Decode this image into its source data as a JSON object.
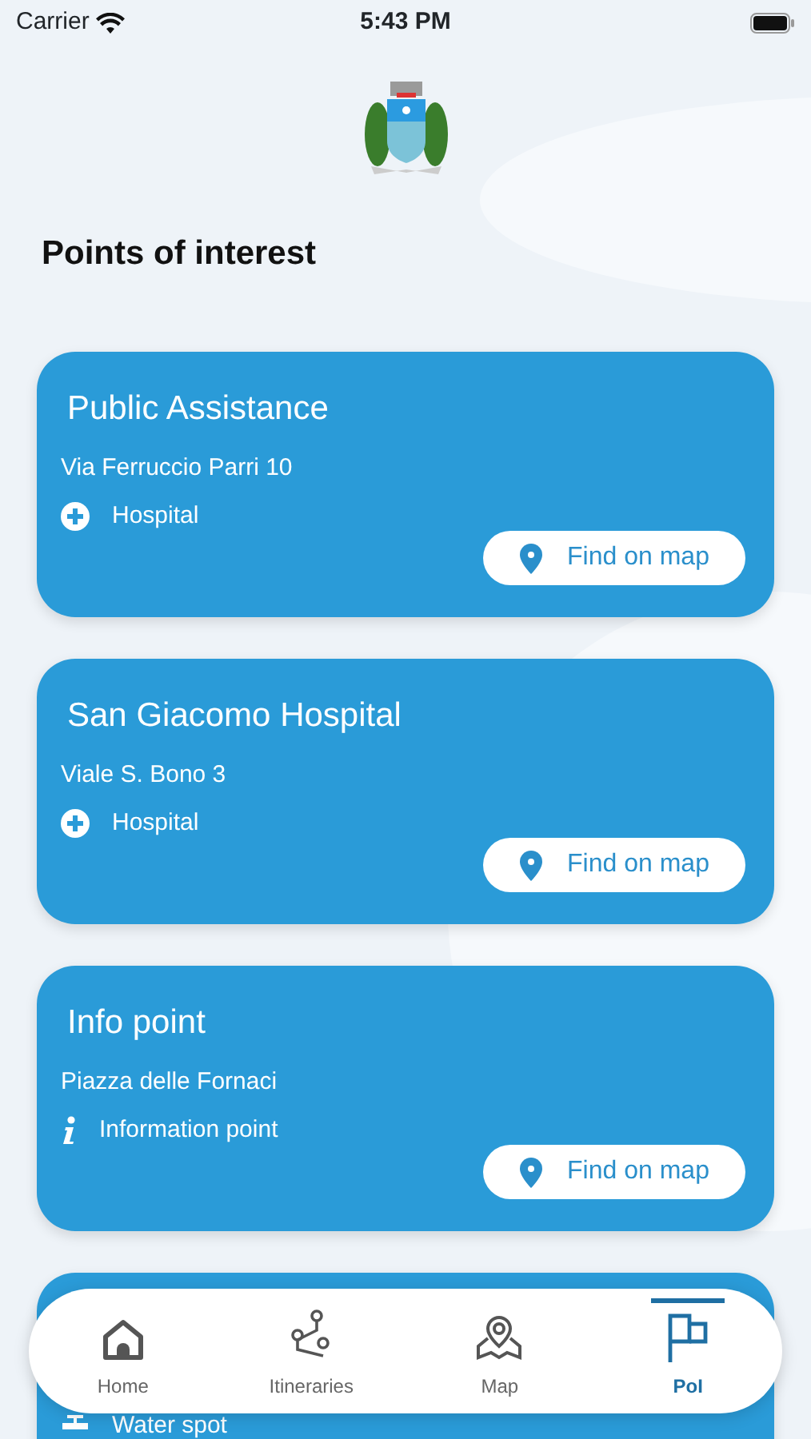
{
  "status_bar": {
    "carrier": "Carrier",
    "time": "5:43 PM"
  },
  "header": {
    "title": "Points of interest"
  },
  "points": [
    {
      "name": "Public Assistance",
      "address": "Via Ferruccio Parri 10",
      "category": {
        "kind": "hospital",
        "label": "Hospital"
      },
      "action": "Find on map"
    },
    {
      "name": "San Giacomo Hospital",
      "address": "Viale S. Bono 3",
      "category": {
        "kind": "hospital",
        "label": "Hospital"
      },
      "action": "Find on map"
    },
    {
      "name": "Info point",
      "address": "Piazza delle Fornaci",
      "category": {
        "kind": "info",
        "label": "Information point"
      },
      "action": "Find on map"
    },
    {
      "category": {
        "kind": "water",
        "label": "Water spot"
      }
    }
  ],
  "tab_bar": [
    {
      "kind": "home",
      "label": "Home",
      "selected": false
    },
    {
      "kind": "itineraries",
      "label": "Itineraries",
      "selected": false
    },
    {
      "kind": "map",
      "label": "Map",
      "selected": false
    },
    {
      "kind": "poi",
      "label": "PoI",
      "selected": true
    }
  ]
}
